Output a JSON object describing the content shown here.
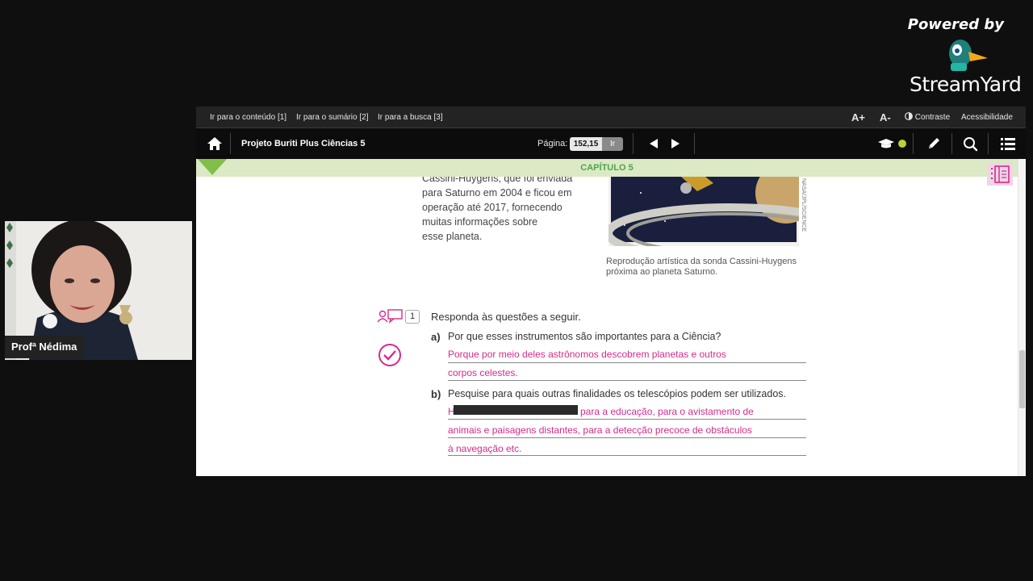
{
  "overlay": {
    "powered_by": "Powered by",
    "brand": "StreamYard",
    "speaker_name": "Profª Nédima"
  },
  "top_links": {
    "content": "Ir para o conteúdo [1]",
    "summary": "Ir para o sumário [2]",
    "search": "Ir para a busca [3]"
  },
  "top_right": {
    "font_up": "A+",
    "font_down": "A-",
    "contrast": "Contraste",
    "accessibility": "Acessibilidade"
  },
  "toolbar": {
    "book_title": "Projeto Buriti Plus Ciências 5",
    "page_label": "Página:",
    "page_value": "152,15",
    "go_label": "Ir"
  },
  "chapter": "CAPÍTULO 5",
  "book": {
    "intro_lines": [
      "Cassini-Huygens, que foi enviada",
      "para Saturno em 2004 e ficou em",
      "operação até 2017, fornecendo",
      "muitas informações sobre",
      "esse planeta."
    ],
    "image_credit": "NASA/JPL/SCIENCE",
    "caption_lines": [
      "Reprodução artística da sonda Cassini-Huygens",
      "próxima ao planeta Saturno."
    ],
    "question_number": "1",
    "question_prompt": "Responda às questões a seguir.",
    "a_label": "a)",
    "a_question": "Por que esses instrumentos são importantes para a Ciência?",
    "a_answer_lines": [
      "Porque por meio deles astrônomos descobrem planetas e outros",
      "corpos celestes."
    ],
    "b_label": "b)",
    "b_question": "Pesquise para quais outras finalidades os telescópios podem ser utilizados.",
    "b_answer_prefix": "H",
    "b_answer_line1_rest": "para a educação, para o avistamento de",
    "b_answer_lines": [
      "animais e paisagens distantes, para a detecção precoce de obstáculos",
      "à navegação etc."
    ]
  },
  "colors": {
    "chapter_green": "#4ea64a",
    "answer_pink": "#d62a8c",
    "toolbar_dark": "#0c0c0c"
  }
}
